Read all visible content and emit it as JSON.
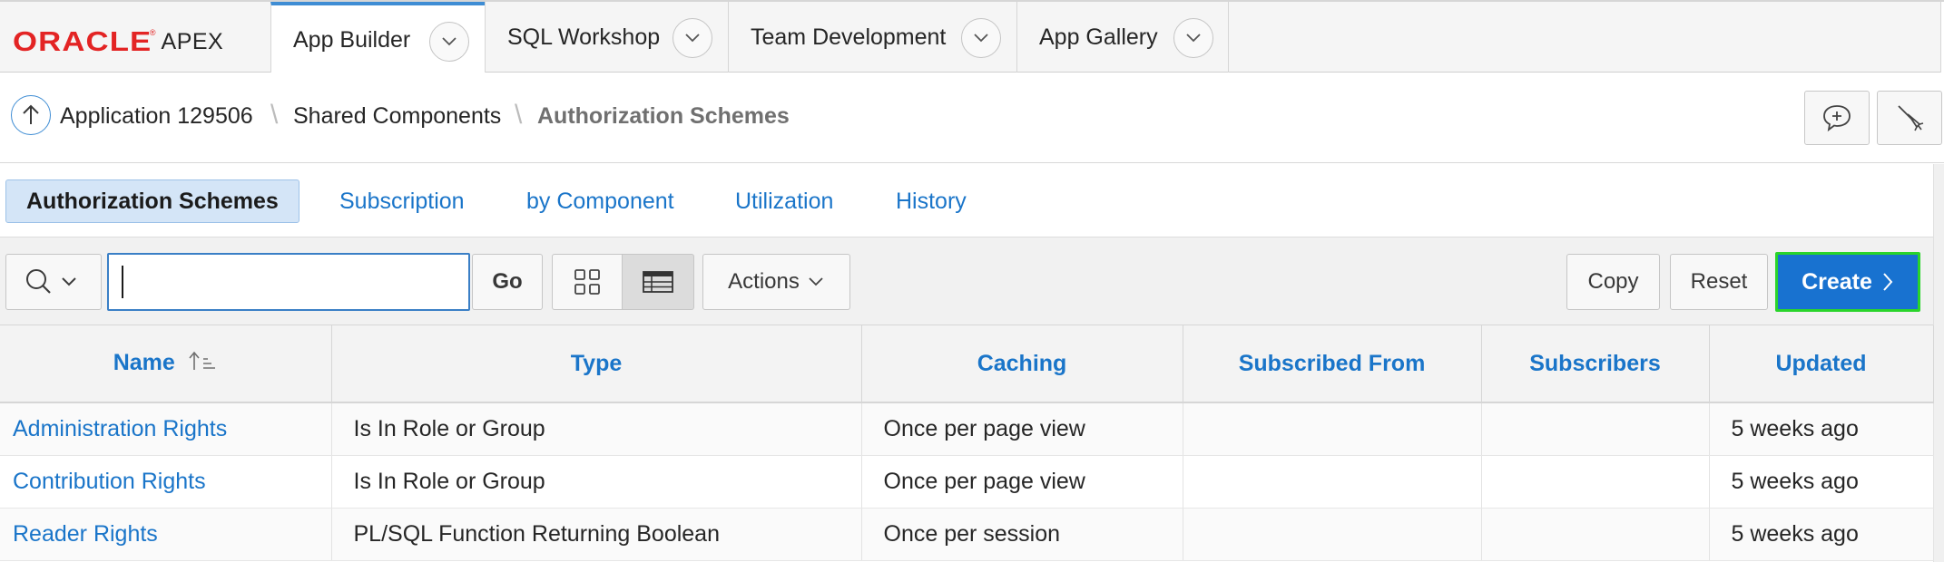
{
  "brand": {
    "oracle": "ORACLE",
    "registered": "®",
    "apex": "APEX",
    "logo_color": "#e32424"
  },
  "topnav": {
    "tabs": [
      {
        "label": "App Builder",
        "active": true
      },
      {
        "label": "SQL Workshop",
        "active": false
      },
      {
        "label": "Team Development",
        "active": false
      },
      {
        "label": "App Gallery",
        "active": false
      }
    ]
  },
  "breadcrumb": {
    "items": [
      "Application 129506",
      "Shared Components",
      "Authorization Schemes"
    ],
    "separator": "\\"
  },
  "subtabs": {
    "items": [
      "Authorization Schemes",
      "Subscription",
      "by Component",
      "Utilization",
      "History"
    ],
    "active_index": 0
  },
  "toolbar": {
    "search_value": "",
    "go_label": "Go",
    "actions_label": "Actions",
    "copy_label": "Copy",
    "reset_label": "Reset",
    "create_label": "Create",
    "view_mode": "report"
  },
  "table": {
    "columns": [
      "Name",
      "Type",
      "Caching",
      "Subscribed From",
      "Subscribers",
      "Updated"
    ],
    "sort_column": "Name",
    "sort_direction": "ascending",
    "rows": [
      {
        "name": "Administration Rights",
        "type": "Is In Role or Group",
        "caching": "Once per page view",
        "subscribed_from": "",
        "subscribers": "",
        "updated": "5 weeks ago"
      },
      {
        "name": "Contribution Rights",
        "type": "Is In Role or Group",
        "caching": "Once per page view",
        "subscribed_from": "",
        "subscribers": "",
        "updated": "5 weeks ago"
      },
      {
        "name": "Reader Rights",
        "type": "PL/SQL Function Returning Boolean",
        "caching": "Once per session",
        "subscribed_from": "",
        "subscribers": "",
        "updated": "5 weeks ago"
      }
    ]
  },
  "colors": {
    "accent": "#1a75c9",
    "create_button": "#1872d0",
    "active_subtab": "#d4e5f7",
    "focus_outline": "#29d42a"
  }
}
